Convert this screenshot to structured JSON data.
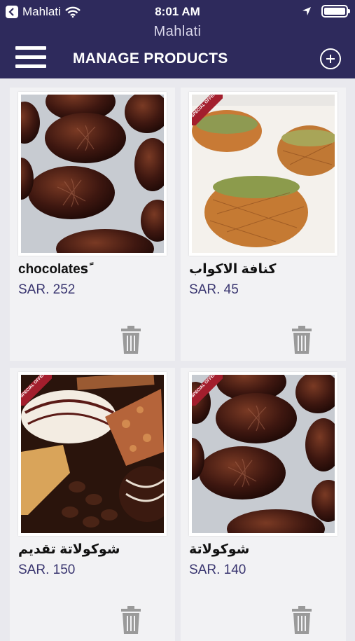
{
  "status_bar": {
    "carrier": "Mahlati",
    "time": "8:01 AM",
    "icons": [
      "back-to-app-icon",
      "wifi-icon",
      "location-arrow-icon",
      "battery-icon"
    ]
  },
  "nav": {
    "app_name": "Mahlati",
    "title": "MANAGE PRODUCTS",
    "menu_icon": "hamburger-menu-icon",
    "add_icon": "add-circle-icon"
  },
  "colors": {
    "header_bg": "#2e2a5c",
    "card_bg": "#f2f2f4",
    "page_bg": "#e9e9ee",
    "price_text": "#3a3670",
    "ribbon": "#a31e2d"
  },
  "products": [
    {
      "name": "chocolatesً",
      "price": "SAR. 252",
      "image": "chocolate-swirl-photo",
      "special_offer": false
    },
    {
      "name": "كنافة الاكواب",
      "price": "SAR. 45",
      "image": "kunafa-cups-photo",
      "special_offer": true,
      "ribbon_text": "SPECIAL OFFER"
    },
    {
      "name": "شوكولاتة تقديم",
      "price": "SAR. 150",
      "image": "chocolate-assortment-photo",
      "special_offer": true,
      "ribbon_text": "SPECIAL OFFER"
    },
    {
      "name": "شوكولاتة",
      "price": "SAR. 140",
      "image": "chocolate-swirl-photo",
      "special_offer": true,
      "ribbon_text": "SPECIAL OFFER"
    }
  ]
}
